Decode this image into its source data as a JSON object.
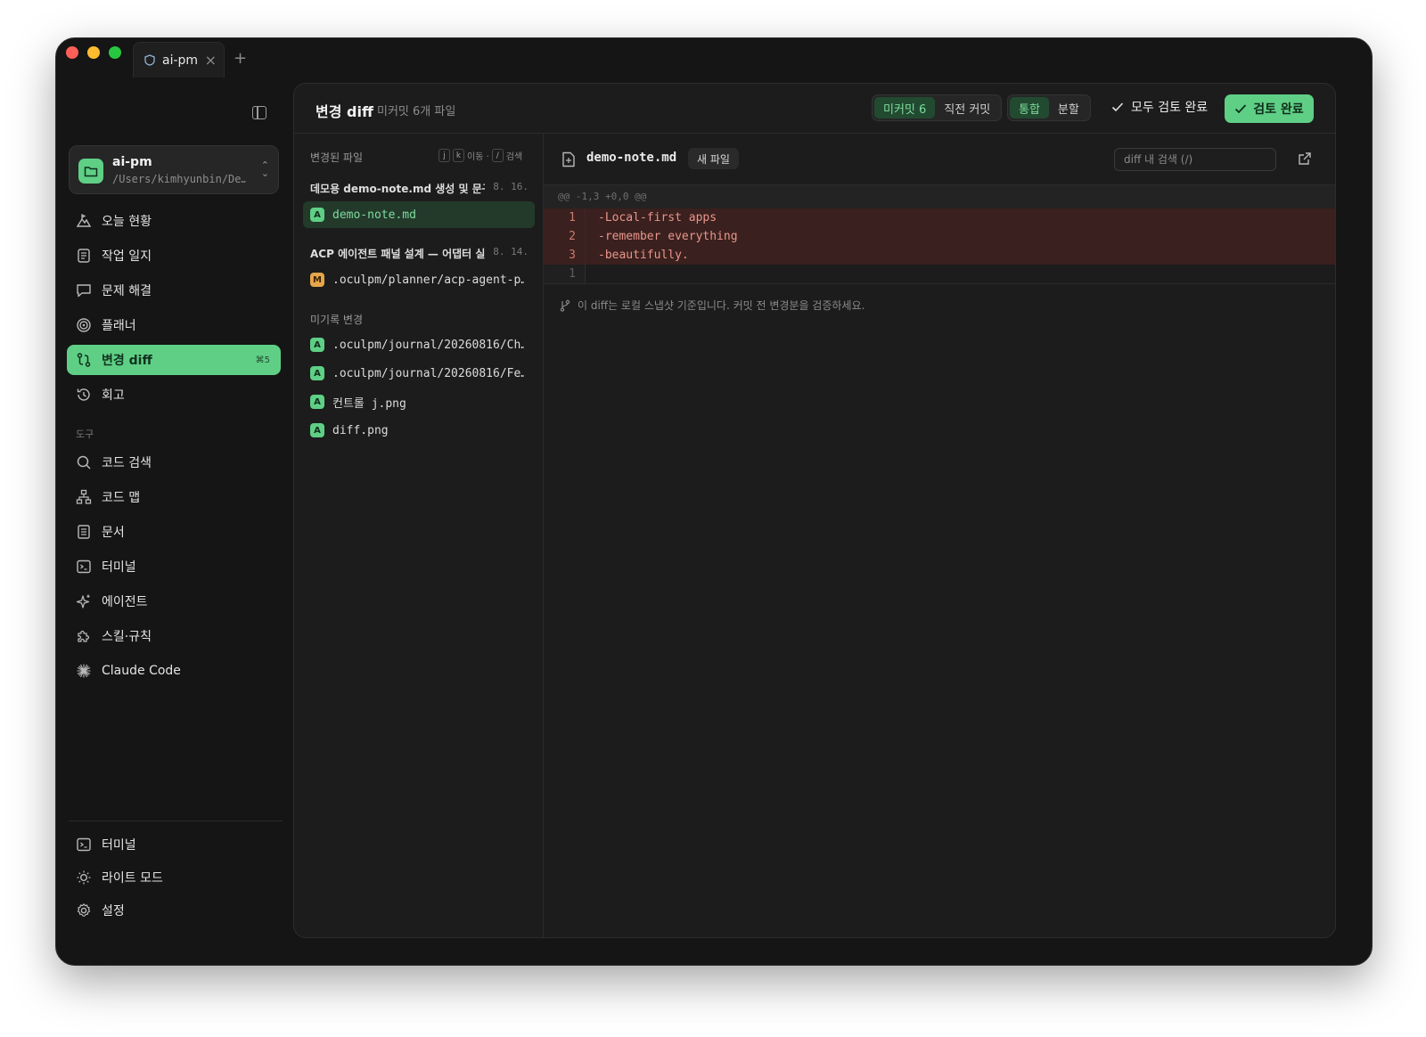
{
  "tab": {
    "title": "ai-pm",
    "close": "×",
    "add": "+"
  },
  "workspace": {
    "name": "ai-pm",
    "path": "/Users/kimhyunbin/De…"
  },
  "nav": [
    {
      "label": "오늘 현황",
      "icon": "summit-icon"
    },
    {
      "label": "작업 일지",
      "icon": "journal-icon"
    },
    {
      "label": "문제 해결",
      "icon": "chat-bubble-icon"
    },
    {
      "label": "플래너",
      "icon": "target-icon"
    },
    {
      "label": "변경 diff",
      "icon": "diff-icon",
      "kbd": "⌘5",
      "active": true
    },
    {
      "label": "회고",
      "icon": "history-icon"
    }
  ],
  "tools_section": "도구",
  "tools": [
    {
      "label": "코드 검색",
      "icon": "search-icon"
    },
    {
      "label": "코드 맵",
      "icon": "sitemap-icon"
    },
    {
      "label": "문서",
      "icon": "document-icon"
    },
    {
      "label": "터미널",
      "icon": "terminal-icon"
    },
    {
      "label": "에이전트",
      "icon": "sparkle-icon"
    },
    {
      "label": "스킬·규칙",
      "icon": "puzzle-icon"
    },
    {
      "label": "Claude Code",
      "icon": "asterisk-icon"
    }
  ],
  "bottom_nav": [
    {
      "label": "터미널",
      "icon": "terminal-icon"
    },
    {
      "label": "라이트 모드",
      "icon": "sun-icon"
    },
    {
      "label": "설정",
      "icon": "gear-icon"
    }
  ],
  "header": {
    "title": "변경 diff",
    "subtitle": "미커밋 6개 파일",
    "scope_tabs": [
      "미커밋 6",
      "직전 커밋"
    ],
    "view_tabs": [
      "통합",
      "분할"
    ],
    "review_all": "모두 검토 완료",
    "review_done": "검토 완료"
  },
  "filelist": {
    "heading": "변경된 파일",
    "hints": {
      "k1": "j",
      "k2": "k",
      "move": "이동 ·",
      "k3": "/",
      "search": "검색"
    },
    "groups": [
      {
        "title": "데모용 demo-note.md 생성 및 문구…",
        "date": "8. 16."
      },
      {
        "title": "ACP 에이전트 패널 설계 — 어댑터 실…",
        "date": "8. 14."
      }
    ],
    "uncommitted_label": "미기록 변경",
    "files": [
      {
        "badge": "A",
        "name": "demo-note.md"
      },
      {
        "badge": "M",
        "name": ".oculpm/planner/acp-agent-p…"
      },
      {
        "badge": "A",
        "name": ".oculpm/journal/20260816/Ch…"
      },
      {
        "badge": "A",
        "name": ".oculpm/journal/20260816/Fe…"
      },
      {
        "badge": "A",
        "name": "컨트롤 j.png"
      },
      {
        "badge": "A",
        "name": "diff.png"
      }
    ]
  },
  "diff": {
    "filename": "demo-note.md",
    "badge": "새 파일",
    "search_placeholder": "diff 내 검색 (/)",
    "hunk": "@@ -1,3 +0,0 @@",
    "lines": [
      {
        "num": "1",
        "code": "-Local-first apps"
      },
      {
        "num": "2",
        "code": "-remember everything"
      },
      {
        "num": "3",
        "code": "-beautifully."
      },
      {
        "num": "1",
        "code": ""
      }
    ],
    "note": "이 diff는 로컬 스냅샷 기준입니다. 커밋 전 변경분을 검증하세요."
  }
}
